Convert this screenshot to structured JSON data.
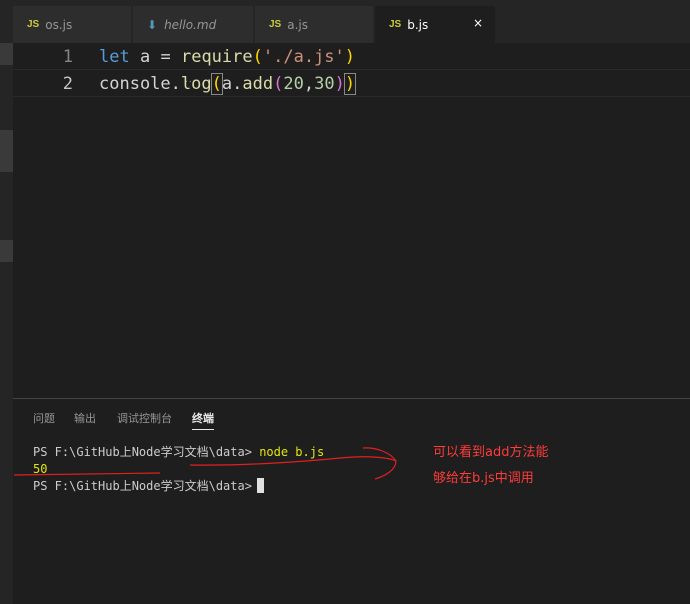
{
  "tabs": [
    {
      "icon": "JS",
      "label": "os.js",
      "active": false
    },
    {
      "icon": "md-icon",
      "label": "hello.md",
      "active": false
    },
    {
      "icon": "JS",
      "label": "a.js",
      "active": false
    },
    {
      "icon": "JS",
      "label": "b.js",
      "active": true
    }
  ],
  "tab_close_glyph": "×",
  "editor": {
    "lines": [
      {
        "number": "1",
        "tokens": [
          "let",
          "a",
          "=",
          "require",
          "(",
          "'./a.js'",
          ")"
        ]
      },
      {
        "number": "2",
        "tokens": [
          "console",
          ".",
          "log",
          "(",
          "a",
          ".",
          "add",
          "(",
          "20",
          ",",
          "30",
          ")",
          ")"
        ]
      }
    ],
    "hint_dots": "..."
  },
  "panel": {
    "tabs": [
      "问题",
      "输出",
      "调试控制台",
      "终端"
    ],
    "active_tab": "终端",
    "terminal": {
      "line1_prompt": "PS F:\\GitHub上Node学习文档\\data>",
      "line1_command": "node b.js",
      "line2_output": "50",
      "line3_prompt": "PS F:\\GitHub上Node学习文档\\data>"
    },
    "annotation": [
      "可以看到add方法能",
      "够给在b.js中调用"
    ]
  },
  "colors": {
    "keyword": "#569cd6",
    "function": "#dcdcaa",
    "string": "#ce9178",
    "number": "#b5cea8",
    "annotation": "#ff3b3b",
    "js_badge": "#cbcb41"
  }
}
